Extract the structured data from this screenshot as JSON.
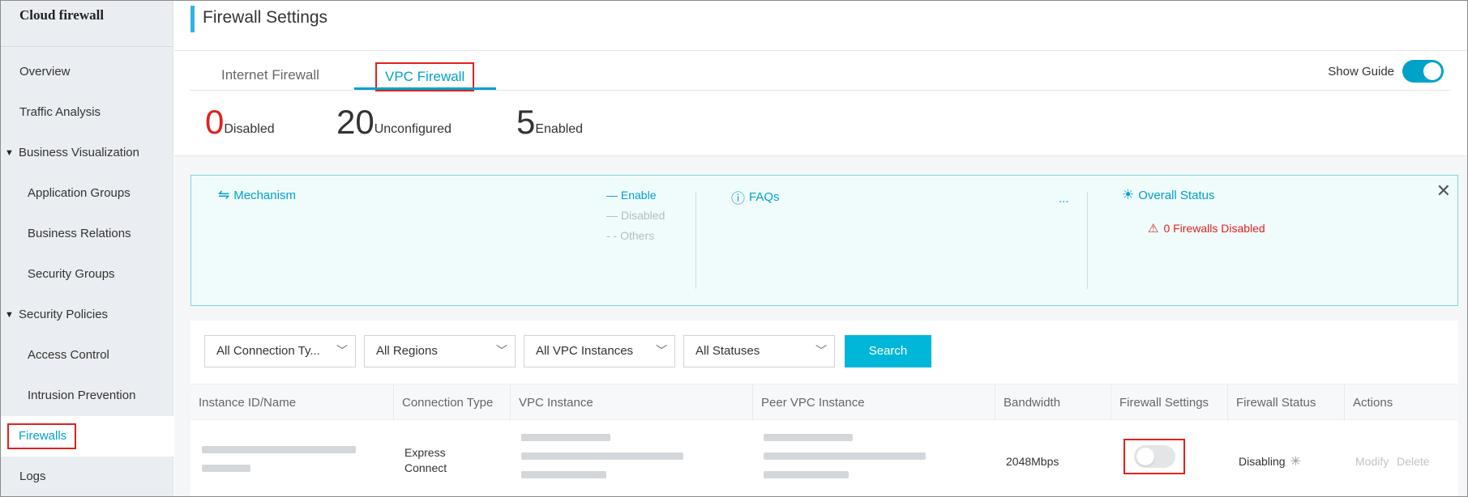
{
  "sidebar": {
    "brand": "Cloud firewall",
    "items": [
      {
        "label": "Overview"
      },
      {
        "label": "Traffic Analysis"
      },
      {
        "label": "Business Visualization"
      },
      {
        "label": "Application Groups"
      },
      {
        "label": "Business Relations"
      },
      {
        "label": "Security Groups"
      },
      {
        "label": "Security Policies"
      },
      {
        "label": "Access Control"
      },
      {
        "label": "Intrusion Prevention"
      },
      {
        "label": "Firewalls"
      },
      {
        "label": "Logs"
      }
    ]
  },
  "header": {
    "title": "Firewall Settings"
  },
  "tabs": [
    {
      "label": "Internet Firewall",
      "active": false
    },
    {
      "label": "VPC Firewall",
      "active": true
    }
  ],
  "show_guide": {
    "label": "Show Guide",
    "on": true
  },
  "stats": [
    {
      "value": "0",
      "label": "Disabled",
      "color": "#e0221d"
    },
    {
      "value": "20",
      "label": "Unconfigured",
      "color": "#333333"
    },
    {
      "value": "5",
      "label": "Enabled",
      "color": "#333333"
    }
  ],
  "guide": {
    "mechanism": "Mechanism",
    "legend": {
      "enable": "— Enable",
      "disabled": "— Disabled",
      "others": "- - Others"
    },
    "faqs": "FAQs",
    "more": "...",
    "overall_status": "Overall Status",
    "warning": "0 Firewalls Disabled"
  },
  "filters": {
    "connection_type": "All Connection Ty...",
    "regions": "All Regions",
    "vpc_instances": "All VPC Instances",
    "statuses": "All Statuses",
    "search": "Search"
  },
  "table": {
    "columns": [
      "Instance ID/Name",
      "Connection Type",
      "VPC Instance",
      "Peer VPC Instance",
      "Bandwidth",
      "Firewall Settings",
      "Firewall Status",
      "Actions"
    ],
    "rows": [
      {
        "connection_type": "Express Connect",
        "bandwidth": "2048Mbps",
        "firewall_enabled": false,
        "status": "Disabling",
        "actions": {
          "modify": "Modify",
          "delete": "Delete"
        }
      }
    ]
  },
  "colors": {
    "accent": "#00a2ca",
    "highlight_box": "#e0221d",
    "warning": "#e0221d"
  }
}
